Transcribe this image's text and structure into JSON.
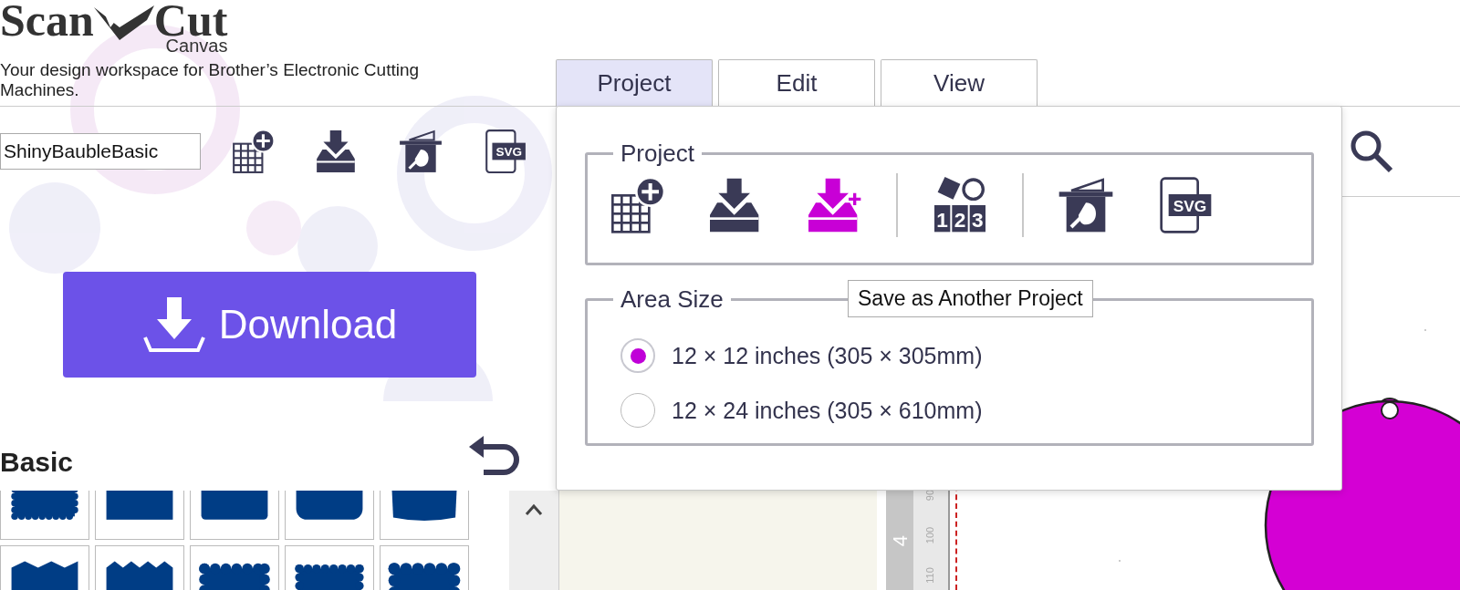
{
  "logo": {
    "word_1": "Scan",
    "word_2": "Cut",
    "subtitle": "Canvas"
  },
  "tagline": "Your design workspace for Brother’s Electronic Cutting Machines.",
  "tabs": [
    {
      "label": "Project",
      "selected": true
    },
    {
      "label": "Edit",
      "selected": false
    },
    {
      "label": "View",
      "selected": false
    }
  ],
  "project_name": {
    "value": "ShinyBaubleBasic"
  },
  "toolbar": [
    {
      "kind": "new",
      "highlighted": false
    },
    {
      "kind": "save",
      "highlighted": false
    },
    {
      "kind": "scan",
      "highlighted": false
    },
    {
      "kind": "svg",
      "highlighted": false,
      "badge": "SVG"
    }
  ],
  "download_button": {
    "label": "Download"
  },
  "category": {
    "title": "Basic"
  },
  "popup": {
    "project_group": {
      "legend": "Project",
      "icon_groups": [
        {
          "icons": [
            {
              "kind": "new",
              "highlighted": false
            },
            {
              "kind": "save",
              "highlighted": false
            },
            {
              "kind": "save_as",
              "highlighted": true
            }
          ]
        },
        {
          "icons": [
            {
              "kind": "numbers",
              "highlighted": false,
              "digits": [
                "1",
                "2",
                "3"
              ]
            }
          ]
        },
        {
          "icons": [
            {
              "kind": "scan",
              "highlighted": false
            },
            {
              "kind": "svg",
              "highlighted": false,
              "badge": "SVG"
            }
          ]
        }
      ]
    },
    "tooltip": "Save as Another Project",
    "area_group": {
      "legend": "Area Size",
      "options": [
        {
          "label": "12 × 12 inches (305 × 305mm)",
          "selected": true
        },
        {
          "label": "12 × 24 inches (305 × 610mm)",
          "selected": false
        }
      ]
    }
  },
  "ruler": {
    "major_label": "4",
    "minor_labels": [
      "90",
      "100",
      "110"
    ]
  }
}
